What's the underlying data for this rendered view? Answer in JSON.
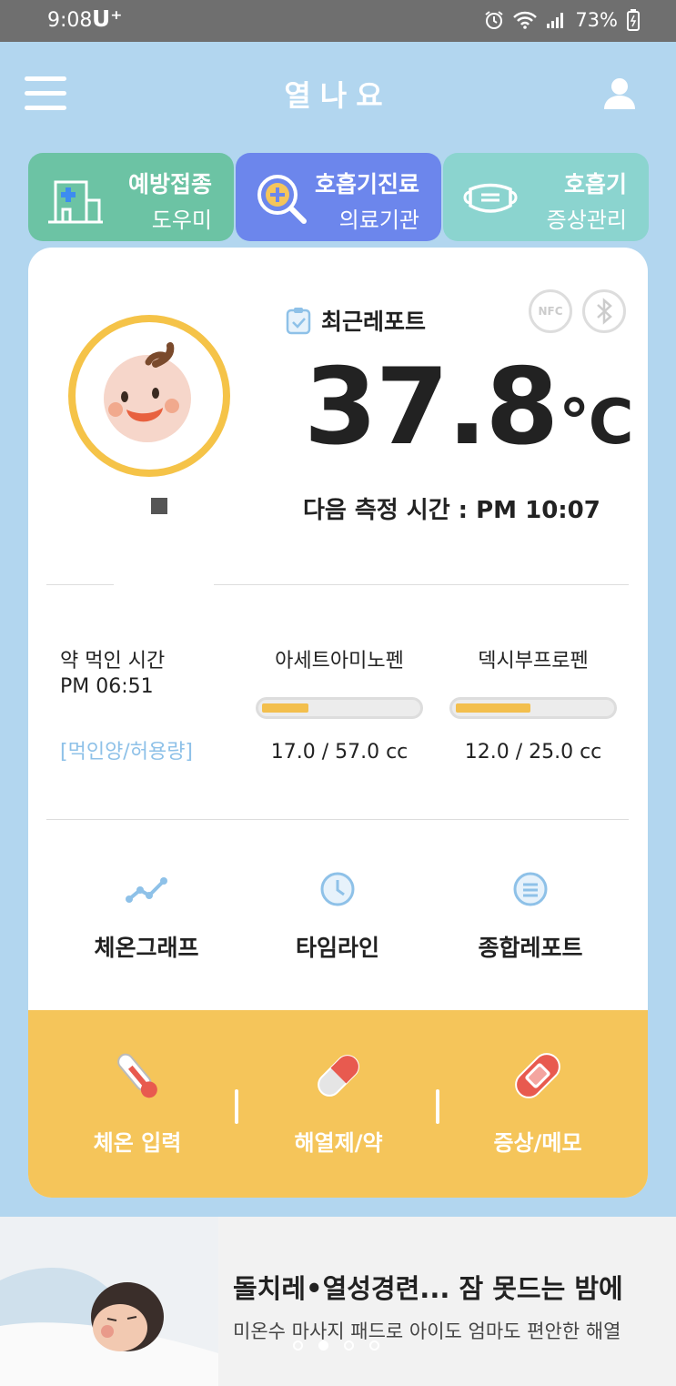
{
  "status_bar": {
    "time": "9:08",
    "carrier": "U⁺",
    "battery": "73%"
  },
  "header": {
    "title": "열나요"
  },
  "tabs": [
    {
      "line1": "예방접종",
      "line2": "도우미",
      "color": "#6cc3a4"
    },
    {
      "line1": "호흡기진료",
      "line2": "의료기관",
      "color": "#6c86ec"
    },
    {
      "line1": "호흡기",
      "line2": "증상관리",
      "color": "#8bd4cf"
    }
  ],
  "report": {
    "label": "최근레포트",
    "nfc_label": "NFC",
    "temperature": "37.8",
    "unit": "℃",
    "next_measure": "다음 측정 시간 : PM 10:07"
  },
  "medication": {
    "time_label": "약 먹인 시간",
    "time_value": "PM 06:51",
    "dose_link": "[먹인양/허용량]",
    "items": [
      {
        "name": "아세트아미노펜",
        "amount": "17.0 / 57.0 cc",
        "fraction": 0.298
      },
      {
        "name": "덱시부프로펜",
        "amount": "12.0 / 25.0 cc",
        "fraction": 0.48
      }
    ]
  },
  "quick_links": [
    {
      "label": "체온그래프",
      "icon": "graph-icon"
    },
    {
      "label": "타임라인",
      "icon": "clock-icon"
    },
    {
      "label": "종합레포트",
      "icon": "list-icon"
    }
  ],
  "actions": [
    {
      "label": "체온 입력",
      "icon": "thermometer-icon"
    },
    {
      "label": "해열제/약",
      "icon": "pill-icon"
    },
    {
      "label": "증상/메모",
      "icon": "bandage-icon"
    }
  ],
  "banner": {
    "title": "돌치레•열성경련... 잠 못드는 밤에",
    "subtitle": "미온수 마사지 패드로 아이도 엄마도 편안한 해열",
    "active_dot": 2,
    "dot_count": 4
  },
  "colors": {
    "background": "#b2d6ef",
    "accent_yellow": "#f5c55a",
    "bar_fill": "#f3bf4d"
  }
}
